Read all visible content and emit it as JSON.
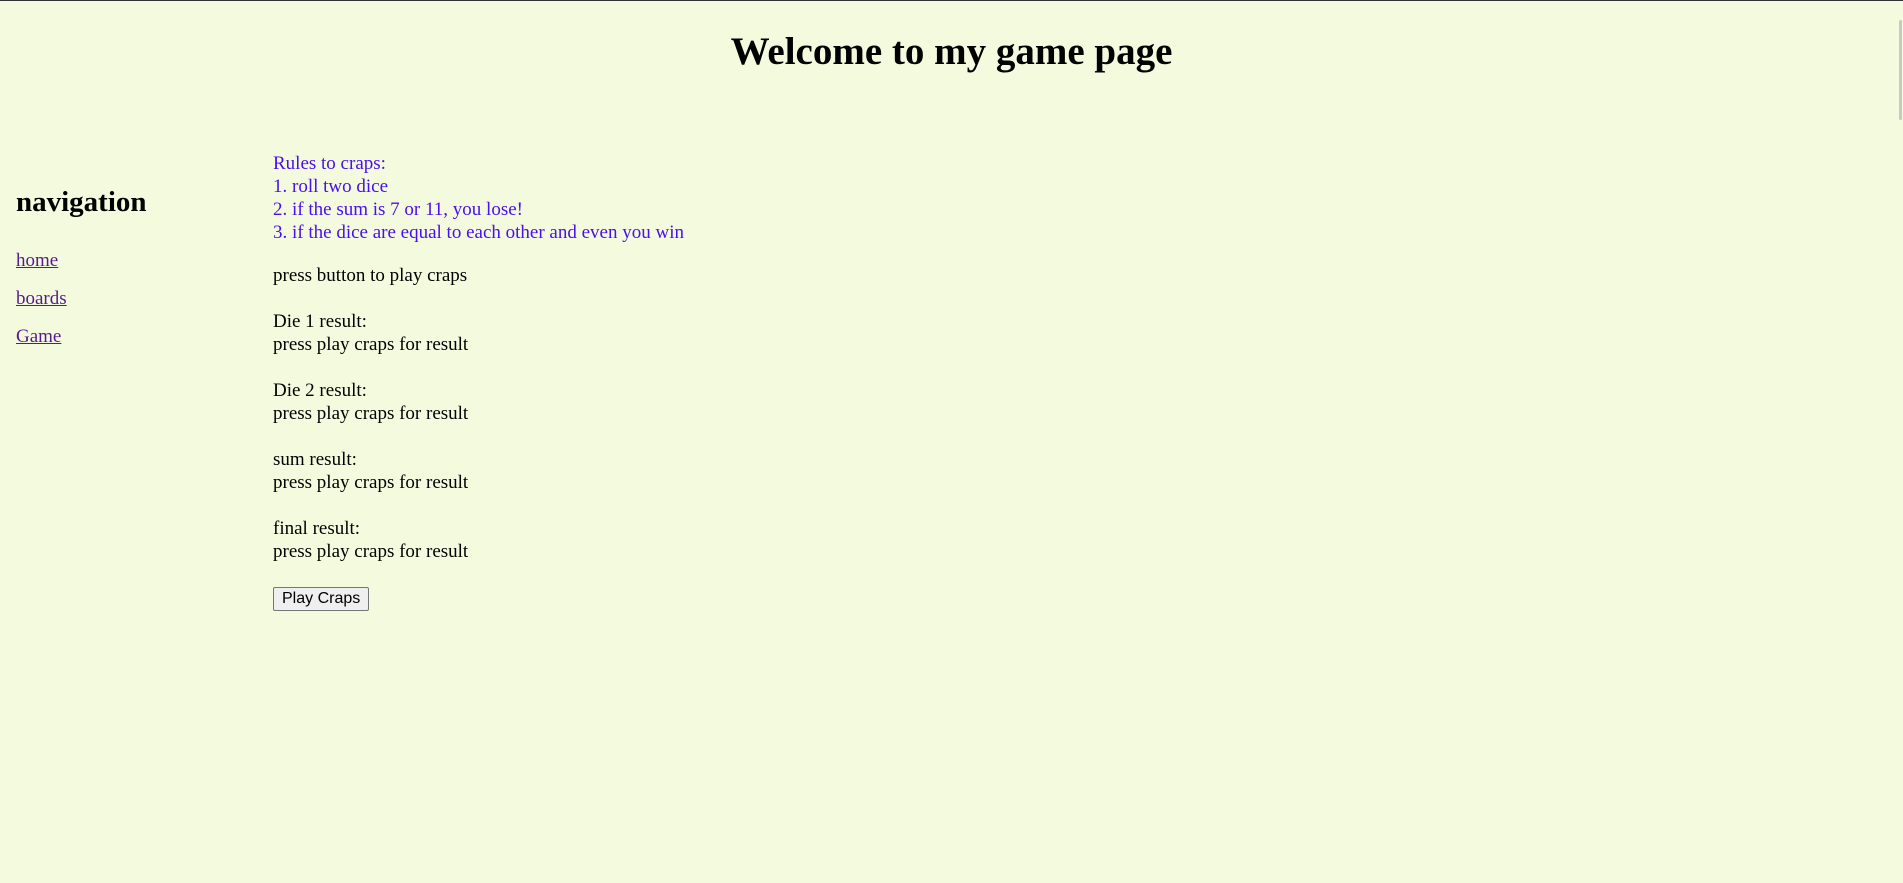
{
  "header": {
    "title": "Welcome to my game page"
  },
  "nav": {
    "heading": "navigation",
    "links": [
      {
        "label": "home"
      },
      {
        "label": "boards"
      },
      {
        "label": "Game"
      }
    ]
  },
  "rules": {
    "title": "Rules to craps:",
    "items": [
      "1. roll two dice",
      "2. if the sum is 7 or 11, you lose!",
      "3. if the dice are equal to each other and even you win"
    ],
    "color": "#4a0ff0"
  },
  "game": {
    "prompt": "press button to play craps",
    "die1_label": "Die 1 result:",
    "die1_value": "press play craps for result",
    "die2_label": "Die 2 result:",
    "die2_value": "press play craps for result",
    "sum_label": "sum result:",
    "sum_value": "press play craps for result",
    "final_label": "final result:",
    "final_value": "press play craps for result",
    "button_label": "Play Craps"
  },
  "colors": {
    "background": "#f4fadd",
    "visited_link": "#551a8b"
  }
}
